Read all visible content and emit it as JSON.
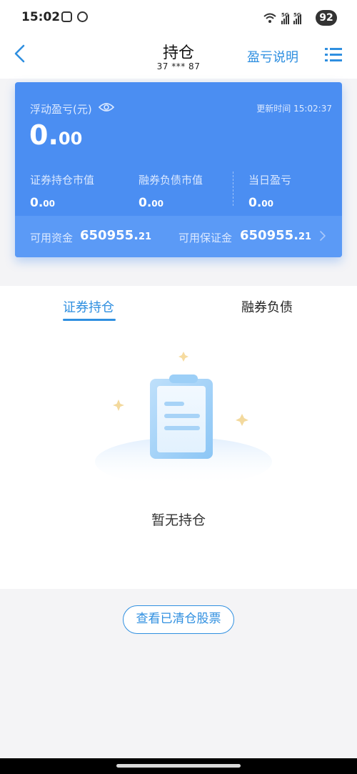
{
  "status_bar": {
    "time": "15:02",
    "battery": "92",
    "network": [
      "5G",
      "5G"
    ]
  },
  "header": {
    "title": "持仓",
    "account": "37 *** 87",
    "explain_link": "盈亏说明"
  },
  "card": {
    "pl_label": "浮动盈亏(元)",
    "update_time": "更新时间 15:02:37",
    "pl_value_main": "0.",
    "pl_value_decimal": "00",
    "metrics": [
      {
        "label": "证券持仓市值",
        "main": "0.",
        "decimal": "00"
      },
      {
        "label": "融券负债市值",
        "main": "0.",
        "decimal": "00"
      },
      {
        "label": "当日盈亏",
        "main": "0.",
        "decimal": "00"
      }
    ],
    "available_funds_label": "可用资金",
    "available_funds_main": "650955.",
    "available_funds_decimal": "21",
    "available_margin_label": "可用保证金",
    "available_margin_main": "650955.",
    "available_margin_decimal": "21"
  },
  "tabs": [
    {
      "label": "证券持仓",
      "active": true
    },
    {
      "label": "融券负债",
      "active": false
    }
  ],
  "empty_state": {
    "text": "暂无持仓"
  },
  "cleared_button": "查看已清仓股票",
  "colors": {
    "accent": "#2f8fe0",
    "card": "#4b8ef2",
    "card_footer": "#5b9af6"
  }
}
